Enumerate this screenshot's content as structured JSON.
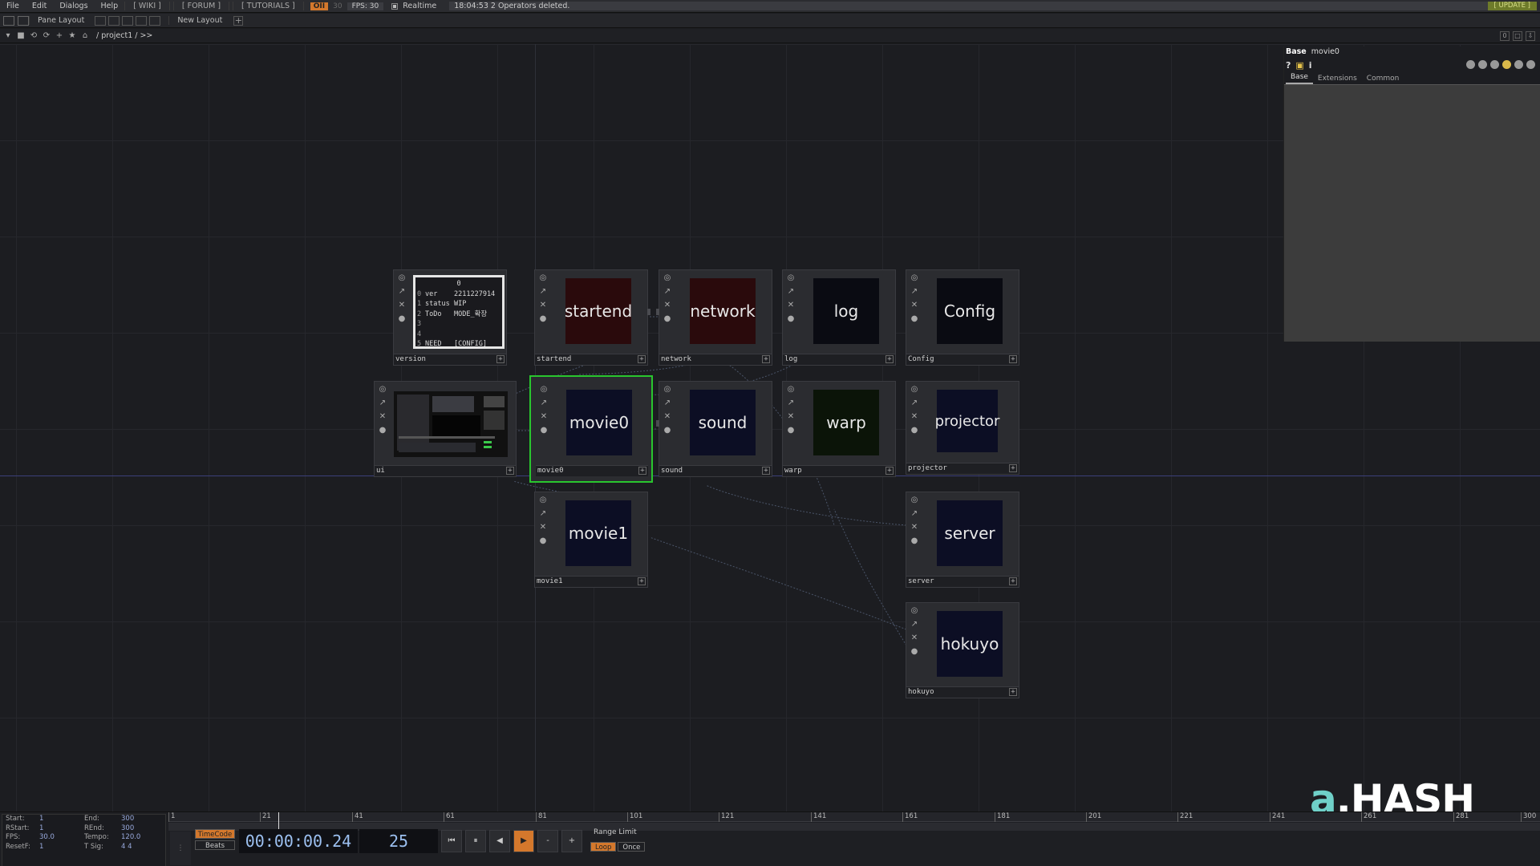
{
  "menubar": {
    "items": [
      "File",
      "Edit",
      "Dialogs",
      "Help"
    ],
    "links": [
      "[ WIKI ]",
      "[ FORUM ]",
      "[ TUTORIALS ]"
    ],
    "oii": "OII",
    "fps_target": "30",
    "fps_label": "FPS: 30",
    "realtime_label": "Realtime",
    "status_message": "18:04:53 2 Operators deleted.",
    "update_label": "[ UPDATE ]"
  },
  "layoutbar": {
    "pane_layout": "Pane Layout",
    "new_layout": "New Layout"
  },
  "pathbar": {
    "path": "/ project1 / >>"
  },
  "operators": {
    "version": {
      "name": "version",
      "header": "0",
      "rows": [
        {
          "i": "0",
          "k": "ver",
          "v": "2211227914"
        },
        {
          "i": "1",
          "k": "status",
          "v": "WIP"
        },
        {
          "i": "2",
          "k": "ToDo",
          "v": "MODE_확장"
        },
        {
          "i": "3",
          "k": "",
          "v": ""
        },
        {
          "i": "4",
          "k": "",
          "v": ""
        },
        {
          "i": "5",
          "k": "NEED",
          "v": "[CONFIG] "
        }
      ]
    },
    "startend": {
      "name": "startend",
      "label": "startend"
    },
    "network": {
      "name": "network",
      "label": "network"
    },
    "log": {
      "name": "log",
      "label": "log"
    },
    "config": {
      "name": "Config",
      "label": "Config"
    },
    "ui": {
      "name": "ui"
    },
    "movie0": {
      "name": "movie0",
      "label": "movie0"
    },
    "sound": {
      "name": "sound",
      "label": "sound"
    },
    "warp": {
      "name": "warp",
      "label": "warp"
    },
    "projector": {
      "name": "projector",
      "label": "projector"
    },
    "movie1": {
      "name": "movie1",
      "label": "movie1"
    },
    "server": {
      "name": "server",
      "label": "server"
    },
    "hokuyo": {
      "name": "hokuyo",
      "label": "hokuyo"
    }
  },
  "param": {
    "type": "Base",
    "name": "movie0",
    "tabs": [
      "Base",
      "Extensions",
      "Common"
    ]
  },
  "watermark": {
    "a": "a",
    "rest": ".HASH"
  },
  "timeline": {
    "ticks": [
      "1",
      "21",
      "41",
      "61",
      "81",
      "101",
      "121",
      "141",
      "161",
      "181",
      "201",
      "221",
      "241",
      "261",
      "281",
      "300"
    ],
    "stats": [
      {
        "k1": "Start:",
        "v1": "1",
        "k2": "End:",
        "v2": "300"
      },
      {
        "k1": "RStart:",
        "v1": "1",
        "k2": "REnd:",
        "v2": "300"
      },
      {
        "k1": "FPS:",
        "v1": "30.0",
        "k2": "Tempo:",
        "v2": "120.0"
      },
      {
        "k1": "ResetF:",
        "v1": "1",
        "k2": "T Sig:",
        "v2": "4    4"
      }
    ],
    "timecode_btn": "TimeCode",
    "beats_btn": "Beats",
    "timecode": "00:00:00.24",
    "frame": "25",
    "range_limit": "Range Limit",
    "loop": "Loop",
    "once": "Once",
    "transport": [
      "⏮",
      "⏸",
      "◀",
      "▶",
      "-",
      "+"
    ]
  }
}
